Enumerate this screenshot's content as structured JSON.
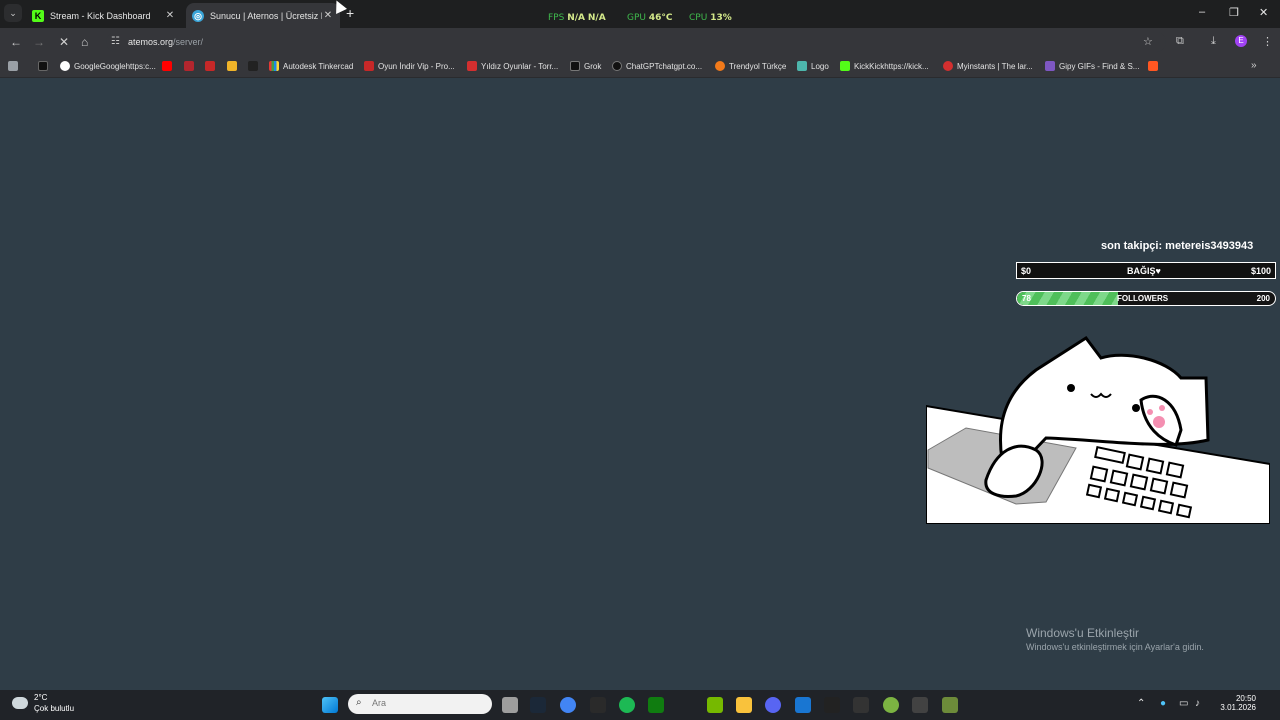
{
  "browser": {
    "tabs": [
      {
        "label": "Stream - Kick Dashboard",
        "favicon": "kick-icon",
        "active": false
      },
      {
        "label": "Sunucu | Aternos | Ücretsiz Min",
        "favicon": "aternos-icon",
        "active": true
      }
    ],
    "perf": {
      "fps_label": "FPS",
      "fps_value": "N/A",
      "fps_value2": "N/A",
      "gpu_label": "GPU",
      "gpu_value": "46°C",
      "cpu_label": "CPU",
      "cpu_value": "13%"
    },
    "url_host": "atemos.org",
    "url_path": "/server/",
    "bookmarks": [
      "GoogleGooglehttps:c...",
      "Autodesk Tinkercad",
      "Oyun İndir Vip - Pro...",
      "Yıldız Oyunlar - Torr...",
      "Grok",
      "ChatGPTchatgpt.co...",
      "Trendyol Türkçe",
      "Logo",
      "KickKickhttps://kick...",
      "Myinstants | The lar...",
      "Gipy GIFs - Find & S..."
    ]
  },
  "overlay": {
    "last_follower": "son takipçi: metereis3493943",
    "donation": {
      "min": "$0",
      "label": "BAĞIŞ♥",
      "max": "$100"
    },
    "followers": {
      "current": "78",
      "label": "FOLLOWERS",
      "goal": "200",
      "progress": 0.39
    }
  },
  "watermark": {
    "line1": "Windows'u Etkinleştir",
    "line2": "Windows'u etkinleştirmek için Ayarlar'a gidin."
  },
  "taskbar": {
    "weather_temp": "2°C",
    "weather_desc": "Çok bulutlu",
    "search_placeholder": "Ara",
    "time": "20:50",
    "date": "3.01.2026"
  }
}
